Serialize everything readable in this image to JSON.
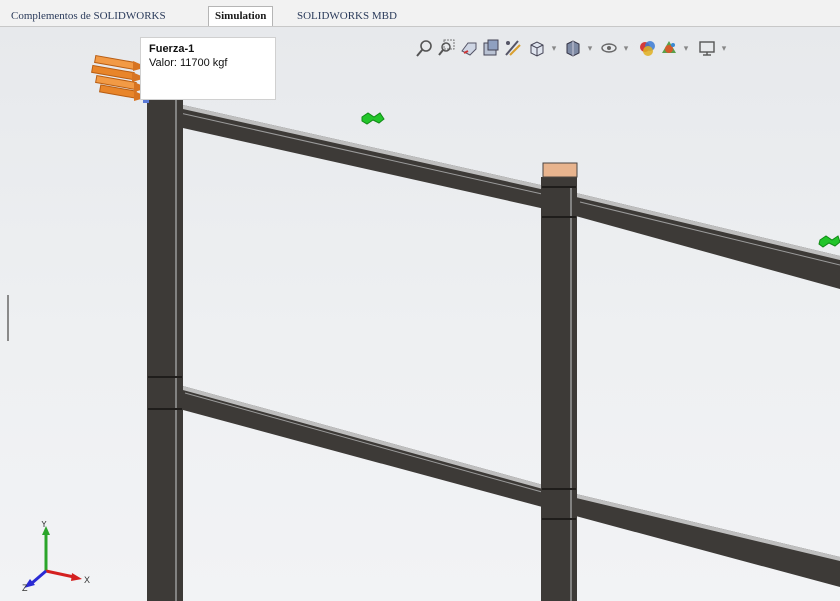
{
  "tabs": [
    {
      "label": "Complementos de SOLIDWORKS",
      "active": false
    },
    {
      "label": "Simulation",
      "active": true
    },
    {
      "label": "SOLIDWORKS MBD",
      "active": false
    }
  ],
  "heads_up_toolbar": [
    {
      "icon": "zoom-to-fit-icon"
    },
    {
      "icon": "zoom-to-area-icon"
    },
    {
      "icon": "previous-view-icon"
    },
    {
      "icon": "section-view-icon"
    },
    {
      "icon": "dynamic-annotation-icon"
    },
    {
      "icon": "view-orientation-icon",
      "dropdown": true
    },
    {
      "icon": "display-style-icon",
      "dropdown": true
    },
    {
      "icon": "hide-show-items-icon",
      "dropdown": true
    },
    {
      "icon": "edit-appearance-icon"
    },
    {
      "icon": "apply-scene-icon",
      "dropdown": true
    },
    {
      "icon": "view-settings-icon",
      "dropdown": true
    }
  ],
  "load_callout": {
    "title": "Fuerza-1",
    "value_text": "Valor: 11700 kgf"
  },
  "triad_axes": [
    "Y",
    "X",
    "Z"
  ],
  "colors": {
    "beam_dark": "#3d3a37",
    "beam_highlight": "#c9c9c9",
    "fixture": "#22c52a",
    "force_arrows": "#e8852a",
    "axis_x": "#d42020",
    "axis_y": "#2aa52a",
    "axis_z": "#2a2ad4"
  }
}
